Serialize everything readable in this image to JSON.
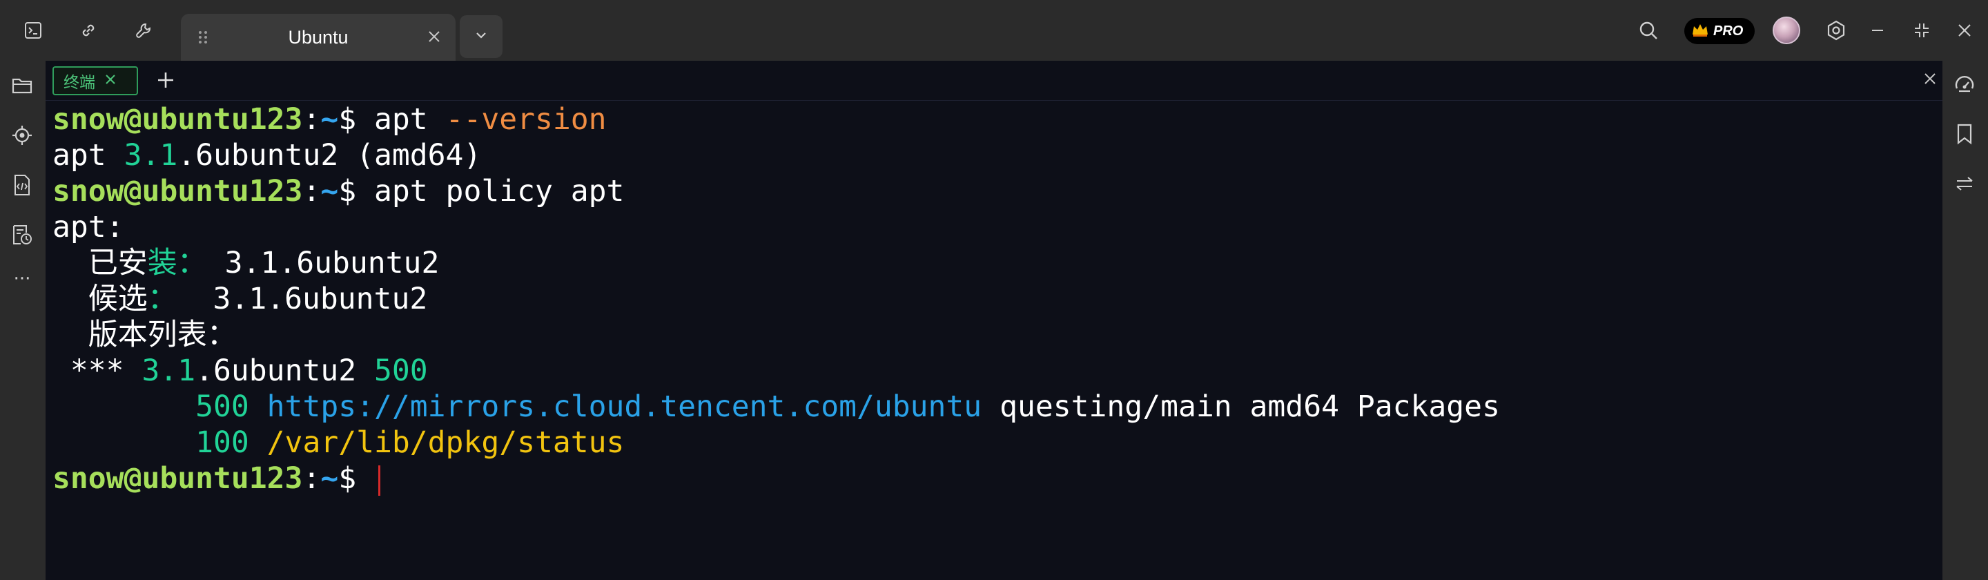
{
  "titlebar": {
    "tab_title": "Ubuntu",
    "pro_label": "PRO",
    "icons": [
      "terminal-icon",
      "link-icon",
      "wrench-icon",
      "grip-icon",
      "close-icon",
      "chevron-down-icon",
      "search-icon",
      "crown-icon",
      "settings-icon",
      "minimize-icon",
      "restore-icon",
      "close-window-icon"
    ]
  },
  "sidebar_left": {
    "icons": [
      "folder-icon",
      "locate-icon",
      "code-icon",
      "history-icon",
      "more-icon"
    ],
    "more_label": "···"
  },
  "sidebar_right": {
    "icons": [
      "gauge-icon",
      "bookmark-icon",
      "transfer-icon"
    ]
  },
  "subbar": {
    "tab_label": "终端",
    "add_label": "+",
    "icons": [
      "close-icon",
      "plus-icon",
      "close-panel-icon"
    ]
  },
  "terminal": {
    "prompt_user": "snow@ubuntu123",
    "prompt_colon": ":",
    "prompt_path": "~",
    "prompt_symbol": "$ ",
    "line1": {
      "cmd": "apt ",
      "arg": "--version"
    },
    "line2": {
      "a": "apt ",
      "b": "3.1",
      "c": ".6ubuntu2 (amd64)"
    },
    "line3": {
      "cmd": "apt policy apt"
    },
    "line4": "apt:",
    "line5": {
      "a": "  已安",
      "b": "装：",
      "c": " 3.1.6ubuntu2"
    },
    "line6": {
      "a": "  候选",
      "b": "：",
      "c": "  3.1.6ubuntu2"
    },
    "line7": "  版本列表：",
    "line8": {
      "a": " *** ",
      "b": "3.1",
      "c": ".6ubuntu2 ",
      "d": "500"
    },
    "line9": {
      "indent": "        ",
      "prio": "500 ",
      "url": "https://mirrors.cloud.tencent.com/ubuntu",
      "rest": " questing/main amd64 Packages"
    },
    "line10": {
      "indent": "        ",
      "prio": "100 ",
      "path": "/var/lib/dpkg/status"
    }
  },
  "colors": {
    "prompt_user": "#a6df5b",
    "prompt_path": "#35a6f0",
    "arg": "#f08d43",
    "version_highlight": "#21d397",
    "url": "#2aa2e8",
    "status_path": "#f2c40f",
    "subtab_border": "#2f9d5b",
    "cursor": "#d62a2a"
  }
}
